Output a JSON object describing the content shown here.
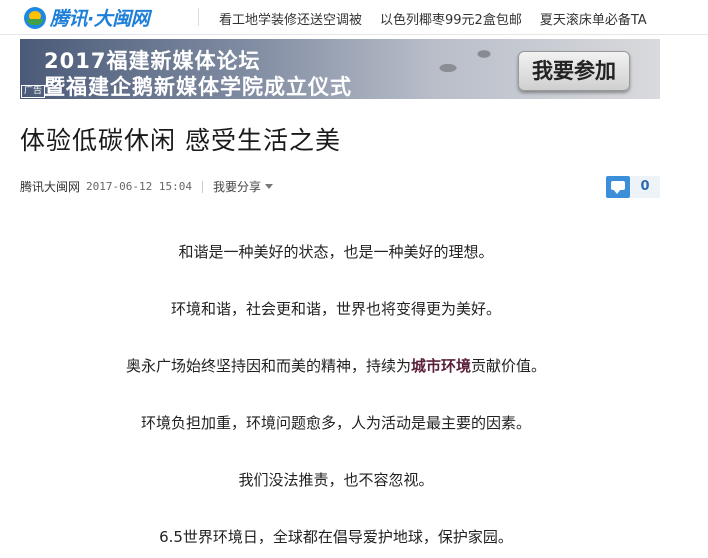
{
  "site": {
    "logo_text": "腾讯·大闽网"
  },
  "topnav": {
    "links": [
      "看工地学装修还送空调被",
      "以色列椰枣99元2盒包邮",
      "夏天滚床单必备TA"
    ]
  },
  "banner": {
    "line1": "2017福建新媒体论坛",
    "line2": "暨福建企鹅新媒体学院成立仪式",
    "button": "我要参加",
    "ad_label": "广告"
  },
  "article": {
    "title": "体验低碳休闲 感受生活之美",
    "source": "腾讯大闽网",
    "date": "2017-06-12 15:04",
    "share_label": "我要分享",
    "comment_count": "0",
    "paragraphs": [
      "和谐是一种美好的状态，也是一种美好的理想。",
      "环境和谐，社会更和谐，世界也将变得更为美好。",
      {
        "before": "奥永广场始终坚持因和而美的精神，持续为",
        "highlight": "城市环境",
        "after": "贡献价值。"
      },
      "环境负担加重，环境问题愈多，人为活动是最主要的因素。",
      "我们没法推责，也不容忽视。",
      "6.5世界环境日，全球都在倡导爱护地球，保护家园。"
    ]
  },
  "colors": {
    "accent": "#1e7fd8",
    "highlight": "#5b1f3a",
    "comment_icon": "#3b8fd8"
  }
}
